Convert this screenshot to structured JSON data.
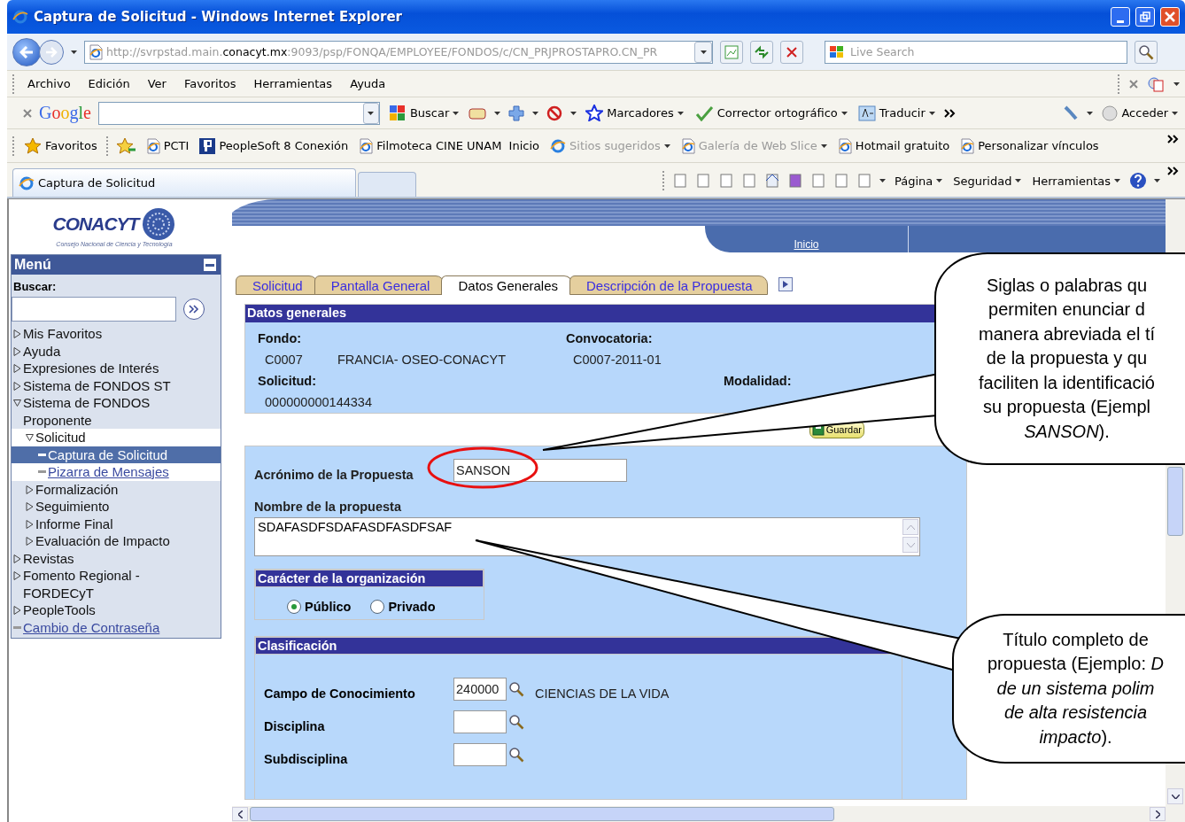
{
  "window": {
    "title": "Captura de Solicitud - Windows Internet Explorer"
  },
  "address_bar": {
    "url_start": "http://svrpstad.main.",
    "url_domain": "conacyt.mx",
    "url_end": ":9093/psp/FONQA/EMPLOYEE/FONDOS/c/CN_PRJPROSTAPRO.CN_PR"
  },
  "search": {
    "placeholder": "Live Search"
  },
  "menu_bar": [
    "Archivo",
    "Edición",
    "Ver",
    "Favoritos",
    "Herramientas",
    "Ayuda"
  ],
  "google_toolbar": {
    "logo": "Google",
    "buttons": [
      "Buscar",
      "Marcadores",
      "Corrector ortográfico",
      "Traducir"
    ],
    "sign_in": "Acceder"
  },
  "favorites_bar": {
    "favorites": "Favoritos",
    "links": [
      {
        "label": "PCTI",
        "kind": "page",
        "disabled": false,
        "dropdown": false
      },
      {
        "label": "PeopleSoft 8 Conexión",
        "kind": "peoplesoft",
        "disabled": false,
        "dropdown": false
      },
      {
        "label": "Filmoteca CINE UNAM  Inicio",
        "kind": "page",
        "disabled": false,
        "dropdown": false
      },
      {
        "label": "Sitios sugeridos",
        "kind": "globe",
        "disabled": true,
        "dropdown": true
      },
      {
        "label": "Galería de Web Slice",
        "kind": "page",
        "disabled": true,
        "dropdown": true
      },
      {
        "label": "Hotmail gratuito",
        "kind": "page",
        "disabled": false,
        "dropdown": false
      },
      {
        "label": "Personalizar vínculos",
        "kind": "page",
        "disabled": false,
        "dropdown": false
      }
    ]
  },
  "tabs": [
    {
      "label": "Captura de Solicitud",
      "selected": true
    }
  ],
  "command_bar": [
    "Página",
    "Seguridad",
    "Herramientas"
  ],
  "sidebar": {
    "logo": "CONACYT",
    "logo_subtitle": "Consejo Nacional de Ciencia y Tecnología",
    "menu_title": "Menú",
    "search_label": "Buscar:",
    "items": [
      {
        "label": "Mis Favoritos",
        "kind": "folder",
        "expanded": false,
        "selected": false
      },
      {
        "label": "Ayuda",
        "kind": "folder",
        "expanded": false,
        "selected": false
      },
      {
        "label": "Expresiones de Interés",
        "kind": "folder",
        "expanded": false,
        "selected": false
      },
      {
        "label": "Sistema de FONDOS ST",
        "kind": "folder",
        "expanded": false,
        "selected": false
      },
      {
        "label": "Sistema de FONDOS Proponente",
        "kind": "folder",
        "expanded": true,
        "selected": false,
        "children": [
          {
            "label": "Solicitud",
            "kind": "folder",
            "expanded": true,
            "selected": false,
            "children": [
              {
                "label": "Captura de Solicitud",
                "kind": "link",
                "selected": true
              },
              {
                "label": "Pizarra de Mensajes",
                "kind": "link",
                "selected": false
              }
            ]
          },
          {
            "label": "Formalización",
            "kind": "folder",
            "expanded": false,
            "selected": false
          },
          {
            "label": "Seguimiento",
            "kind": "folder",
            "expanded": false,
            "selected": false
          },
          {
            "label": "Informe Final",
            "kind": "folder",
            "expanded": false,
            "selected": false
          },
          {
            "label": "Evaluación de Impacto",
            "kind": "folder",
            "expanded": false,
            "selected": false
          }
        ]
      },
      {
        "label": "Revistas",
        "kind": "folder",
        "expanded": false,
        "selected": false
      },
      {
        "label": "Fomento Regional - FORDECyT",
        "kind": "folder",
        "expanded": false,
        "selected": false
      },
      {
        "label": "PeopleTools",
        "kind": "folder",
        "expanded": false,
        "selected": false
      },
      {
        "label": "Cambio de Contraseña",
        "kind": "link",
        "selected": false
      }
    ]
  },
  "header_links": [
    "Inicio"
  ],
  "page_tabs": [
    {
      "label": "Solicitud",
      "selected": false
    },
    {
      "label": "Pantalla General",
      "selected": false
    },
    {
      "label": "Datos Generales",
      "selected": true
    },
    {
      "label": "Descripción de la Propuesta",
      "selected": false
    }
  ],
  "general": {
    "title": "Datos generales",
    "fondo_label": "Fondo:",
    "fondo_code": "C0007",
    "fondo_name": "FRANCIA- OSEO-CONACYT",
    "convocatoria_label": "Convocatoria:",
    "convocatoria": "C0007-2011-01",
    "solicitud_label": "Solicitud:",
    "solicitud": "000000000144334",
    "modalidad_label": "Modalidad:"
  },
  "save_button": "Guardar",
  "form": {
    "acronym_label": "Acrónimo de la Propuesta",
    "acronym": "SANSON",
    "name_label": "Nombre de la propuesta",
    "name": "SDAFASDFSDAFASDFASDFSAF",
    "organization": {
      "title": "Carácter de la organización",
      "options": [
        {
          "label": "Público",
          "selected": true
        },
        {
          "label": "Privado",
          "selected": false
        }
      ]
    },
    "classification": {
      "title": "Clasificación",
      "rows": [
        {
          "label": "Campo de Conocimiento",
          "code": "240000",
          "description": "CIENCIAS DE LA VIDA"
        },
        {
          "label": "Disciplina"
        },
        {
          "label": "Subdisciplina"
        }
      ]
    }
  },
  "callouts": [
    {
      "lines": [
        "Siglas o palabras qu",
        "permiten enunciar d",
        "manera abreviada el tí",
        "de la propuesta y qu",
        "faciliten la identificació",
        "su propuesta  (Ejempl",
        "*SANSON*)."
      ]
    },
    {
      "lines": [
        "Título completo de",
        "propuesta (Ejemplo: *D*",
        "*de un sistema polim*",
        "*de alta resistencia*",
        "*impacto*)."
      ]
    }
  ]
}
